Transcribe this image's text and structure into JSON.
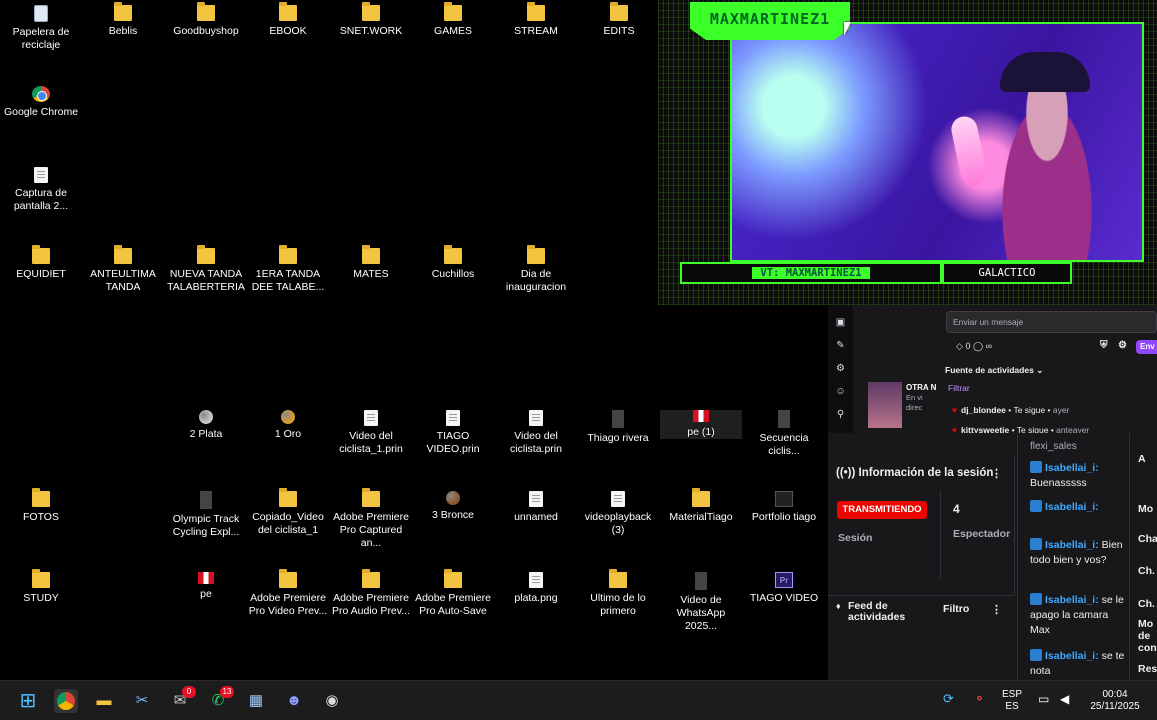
{
  "desktop": {
    "icons": [
      {
        "label": "Papelera de reciclaje",
        "kind": "recycle"
      },
      {
        "label": "Beblis",
        "kind": "folder"
      },
      {
        "label": "Goodbuyshop",
        "kind": "folder"
      },
      {
        "label": "EBOOK",
        "kind": "folder"
      },
      {
        "label": "SNET.WORK",
        "kind": "folder"
      },
      {
        "label": "GAMES",
        "kind": "folder"
      },
      {
        "label": "STREAM",
        "kind": "folder"
      },
      {
        "label": "EDITS",
        "kind": "folder"
      },
      {
        "label": "Google Chrome",
        "kind": "chrome"
      },
      {
        "label": "Captura de pantalla 2...",
        "kind": "doc"
      },
      {
        "label": "EQUIDIET",
        "kind": "folder"
      },
      {
        "label": "ANTEULTIMA TANDA",
        "kind": "folder"
      },
      {
        "label": "NUEVA TANDA TALABERTERIA",
        "kind": "folder"
      },
      {
        "label": "1ERA TANDA DEE TALABE...",
        "kind": "folder"
      },
      {
        "label": "MATES",
        "kind": "folder"
      },
      {
        "label": "Cuchillos",
        "kind": "folder"
      },
      {
        "label": "Dia de inauguracion",
        "kind": "folder"
      },
      {
        "label": "2 Plata",
        "kind": "medal-silver"
      },
      {
        "label": "1 Oro",
        "kind": "medal-gold"
      },
      {
        "label": "Video del ciclista_1.prin",
        "kind": "doc"
      },
      {
        "label": "TIAGO VIDEO.prin",
        "kind": "doc"
      },
      {
        "label": "Video del ciclista.prin",
        "kind": "doc"
      },
      {
        "label": "Thiago rivera",
        "kind": "dark"
      },
      {
        "label": "pe (1)",
        "kind": "flag"
      },
      {
        "label": "Secuencia ciclis...",
        "kind": "dark"
      },
      {
        "label": "FOTOS",
        "kind": "folder"
      },
      {
        "label": "Olympic Track Cycling Expl...",
        "kind": "dark"
      },
      {
        "label": "Copiado_Video del ciclista_1",
        "kind": "folder"
      },
      {
        "label": "Adobe Premiere Pro Captured an...",
        "kind": "folder"
      },
      {
        "label": "3 Bronce",
        "kind": "medal-bronze"
      },
      {
        "label": "unnamed",
        "kind": "doc"
      },
      {
        "label": "videoplayback (3)",
        "kind": "doc"
      },
      {
        "label": "MaterialTiago",
        "kind": "folder"
      },
      {
        "label": "Portfolio tiago",
        "kind": "video"
      },
      {
        "label": "STUDY",
        "kind": "folder"
      },
      {
        "label": "pe",
        "kind": "flag"
      },
      {
        "label": "Adobe Premiere Pro Video Prev...",
        "kind": "folder"
      },
      {
        "label": "Adobe Premiere Pro Audio Prev...",
        "kind": "folder"
      },
      {
        "label": "Adobe Premiere Pro Auto-Save",
        "kind": "folder"
      },
      {
        "label": "plata.png",
        "kind": "doc"
      },
      {
        "label": "Ultimo de lo primero",
        "kind": "folder"
      },
      {
        "label": "Video de WhatsApp 2025...",
        "kind": "dark"
      },
      {
        "label": "TIAGO VIDEO",
        "kind": "premiere"
      }
    ]
  },
  "stream": {
    "streamer_name": "MAXMARTINEZ1",
    "vt_label": "VT: MAXMARTINEZ1",
    "galactico_label": "GALACTICO"
  },
  "dashboard": {
    "message_placeholder": "Enviar un mensaje",
    "send_label": "Env",
    "counter": "0",
    "counter_infinite": "∞",
    "activity_feed_header": "Fuente de actividades",
    "filter_label": "Filtrar",
    "otra_title": "OTRA N",
    "otra_sub1": "En vi",
    "otra_sub2": "direc",
    "feed_items": [
      {
        "user": "dj_blondee",
        "action": "Te sigue",
        "time": "ayer"
      },
      {
        "user": "kittysweetie",
        "action": "Te sigue",
        "time": "anteayer"
      }
    ],
    "session": {
      "title": "Información de la sesión",
      "live_label": "TRANSMITIENDO",
      "session_label": "Sesión",
      "viewer_count": "4",
      "viewer_label": "Espectador"
    },
    "activity_panel": {
      "title": "Feed de actividades",
      "filter": "Filtro"
    },
    "chat": {
      "top_user": "flexi_sales",
      "messages": [
        {
          "user": "Isabellai_i:",
          "text": "Buenasssss"
        },
        {
          "user": "Isabellai_i:",
          "text": ""
        },
        {
          "user": "Isabellai_i:",
          "text": "Bien todo bien y vos?"
        },
        {
          "user": "Isabellai_i:",
          "text": "se le apago la camara Max"
        },
        {
          "user": "Isabellai_i:",
          "text": "se te nota"
        }
      ]
    },
    "right_strip": [
      "A",
      "Mo",
      "Cha",
      "Ch.",
      "Ch.",
      "Mo de con",
      "Res"
    ]
  },
  "taskbar": {
    "whatsapp_badge": "13",
    "mail_badge": "0",
    "language_top": "ESP",
    "language_bottom": "ES",
    "time": "00:04",
    "date": "25/11/2025"
  },
  "colors": {
    "stream_green": "#3cff2a",
    "twitch_purple": "#9147ff",
    "live_red": "#eb0400",
    "chat_user_blue": "#3fa8ff",
    "folder_yellow": "#f3c440"
  }
}
